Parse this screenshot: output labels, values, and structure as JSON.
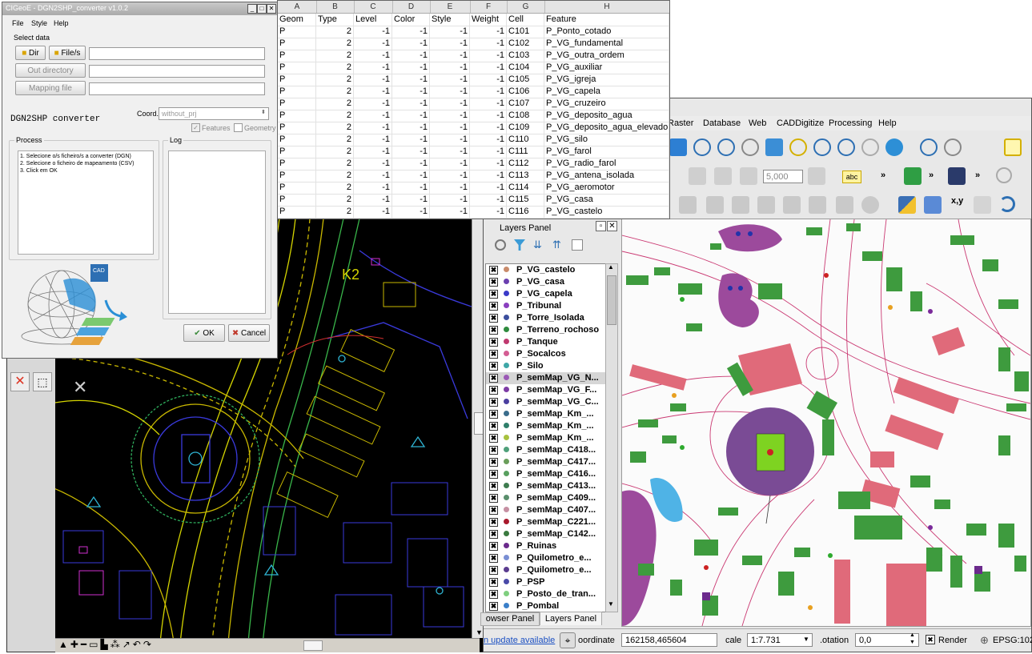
{
  "converter": {
    "title": "CIGeoE - DGN2SHP_converter v1.0.2",
    "menu": [
      "File",
      "Style",
      "Help"
    ],
    "select_data": "Select data",
    "dir_button": "Dir",
    "files_button": "File/s",
    "outdir_button": "Out directory",
    "mapping_button": "Mapping file",
    "app_name": "DGN2SHP converter",
    "coord_label": "Coord.",
    "coord_value": "without_prj",
    "features_label": "Features",
    "geometry_label": "Geometry",
    "process_label": "Process",
    "log_label": "Log",
    "process_steps": [
      "1. Selecione o/s ficheiro/s a converter (DGN)",
      "2. Selecione o ficheiro de mapeamento (CSV)",
      "3. Click em OK"
    ],
    "cad_badge": "CAD",
    "ok_button": "OK",
    "cancel_button": "Cancel"
  },
  "sheet": {
    "columns": [
      "A",
      "B",
      "C",
      "D",
      "E",
      "F",
      "G",
      "H"
    ],
    "header": [
      "Geom",
      "Type",
      "Level",
      "Color",
      "Style",
      "Weight",
      "Cell",
      "Feature"
    ],
    "rows": [
      [
        "P",
        "2",
        "-1",
        "-1",
        "-1",
        "-1",
        "C101",
        "P_Ponto_cotado"
      ],
      [
        "P",
        "2",
        "-1",
        "-1",
        "-1",
        "-1",
        "C102",
        "P_VG_fundamental"
      ],
      [
        "P",
        "2",
        "-1",
        "-1",
        "-1",
        "-1",
        "C103",
        "P_VG_outra_ordem"
      ],
      [
        "P",
        "2",
        "-1",
        "-1",
        "-1",
        "-1",
        "C104",
        "P_VG_auxiliar"
      ],
      [
        "P",
        "2",
        "-1",
        "-1",
        "-1",
        "-1",
        "C105",
        "P_VG_igreja"
      ],
      [
        "P",
        "2",
        "-1",
        "-1",
        "-1",
        "-1",
        "C106",
        "P_VG_capela"
      ],
      [
        "P",
        "2",
        "-1",
        "-1",
        "-1",
        "-1",
        "C107",
        "P_VG_cruzeiro"
      ],
      [
        "P",
        "2",
        "-1",
        "-1",
        "-1",
        "-1",
        "C108",
        "P_VG_deposito_agua"
      ],
      [
        "P",
        "2",
        "-1",
        "-1",
        "-1",
        "-1",
        "C109",
        "P_VG_deposito_agua_elevado"
      ],
      [
        "P",
        "2",
        "-1",
        "-1",
        "-1",
        "-1",
        "C110",
        "P_VG_silo"
      ],
      [
        "P",
        "2",
        "-1",
        "-1",
        "-1",
        "-1",
        "C111",
        "P_VG_farol"
      ],
      [
        "P",
        "2",
        "-1",
        "-1",
        "-1",
        "-1",
        "C112",
        "P_VG_radio_farol"
      ],
      [
        "P",
        "2",
        "-1",
        "-1",
        "-1",
        "-1",
        "C113",
        "P_VG_antena_isolada"
      ],
      [
        "P",
        "2",
        "-1",
        "-1",
        "-1",
        "-1",
        "C114",
        "P_VG_aeromotor"
      ],
      [
        "P",
        "2",
        "-1",
        "-1",
        "-1",
        "-1",
        "C115",
        "P_VG_casa"
      ],
      [
        "P",
        "2",
        "-1",
        "-1",
        "-1",
        "-1",
        "C116",
        "P_VG_castelo"
      ]
    ]
  },
  "cad": {
    "label_k2": "K2"
  },
  "qgis": {
    "menu": [
      "Raster",
      "Database",
      "Web",
      "CADDigitize",
      "Processing",
      "Help"
    ],
    "scale_input": "5,000",
    "abc_label": "abc",
    "xy_label": "x,y",
    "layers_panel_title": "Layers Panel",
    "layers": [
      {
        "name": "P_VG_castelo",
        "color": "#c98b6b"
      },
      {
        "name": "P_VG_casa",
        "color": "#6b3fb0"
      },
      {
        "name": "P_VG_capela",
        "color": "#3b3bc9"
      },
      {
        "name": "P_Tribunal",
        "color": "#8a3fbf"
      },
      {
        "name": "P_Torre_Isolada",
        "color": "#3c4f9e"
      },
      {
        "name": "P_Terreno_rochoso",
        "color": "#2e8b3e"
      },
      {
        "name": "P_Tanque",
        "color": "#c0396f"
      },
      {
        "name": "P_Socalcos",
        "color": "#d45d93"
      },
      {
        "name": "P_Silo",
        "color": "#3fa7a7"
      },
      {
        "name": "P_semMap_VG_N...",
        "color": "#9b59b6"
      },
      {
        "name": "P_semMap_VG_F...",
        "color": "#7d3ca5"
      },
      {
        "name": "P_semMap_VG_C...",
        "color": "#4b3fa0"
      },
      {
        "name": "P_semMap_Km_...",
        "color": "#3a6d8c"
      },
      {
        "name": "P_semMap_Km_...",
        "color": "#2f7f6b"
      },
      {
        "name": "P_semMap_Km_...",
        "color": "#a8c23f"
      },
      {
        "name": "P_semMap_C418...",
        "color": "#4fa07a"
      },
      {
        "name": "P_semMap_C417...",
        "color": "#6a9e5a"
      },
      {
        "name": "P_semMap_C416...",
        "color": "#58a05f"
      },
      {
        "name": "P_semMap_C413...",
        "color": "#3e7c4f"
      },
      {
        "name": "P_semMap_C409...",
        "color": "#5a8f6d"
      },
      {
        "name": "P_semMap_C407...",
        "color": "#c690a3"
      },
      {
        "name": "P_semMap_C221...",
        "color": "#a8192c"
      },
      {
        "name": "P_semMap_C142...",
        "color": "#3a7a3f"
      },
      {
        "name": "P_Ruinas",
        "color": "#6b2a8c"
      },
      {
        "name": "P_Quilometro_e...",
        "color": "#7a8fd4"
      },
      {
        "name": "P_Quilometro_e...",
        "color": "#5b3c8f"
      },
      {
        "name": "P_PSP",
        "color": "#4a4aa8"
      },
      {
        "name": "P_Posto_de_tran...",
        "color": "#7fcf7f"
      },
      {
        "name": "P_Pombal",
        "color": "#3a7fc9"
      }
    ],
    "tabs": [
      "owser Panel",
      "Layers Panel"
    ],
    "update_link": "n update available",
    "coordinate_label": "oordinate",
    "coordinate_value": "162158,465604",
    "scale_label": "cale",
    "scale_value": "1:7.731",
    "rotation_label": ".otation",
    "rotation_value": "0,0",
    "render_label": "Render",
    "epsg_label": "EPSG:102"
  }
}
